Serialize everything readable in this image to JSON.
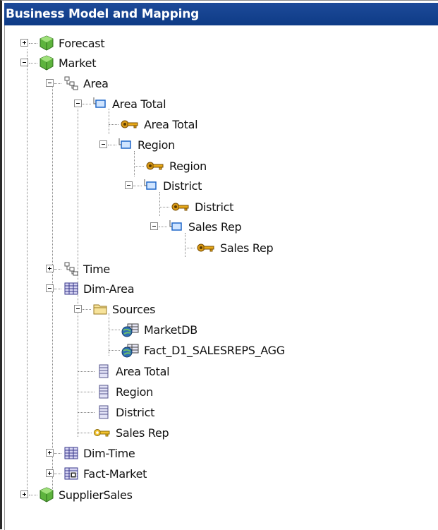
{
  "title": "Business Model and Mapping",
  "tree": {
    "forecast": "Forecast",
    "market": "Market",
    "area": "Area",
    "area_total_level": "Area Total",
    "area_total_key": "Area Total",
    "region_level": "Region",
    "region_key": "Region",
    "district_level": "District",
    "district_key": "District",
    "salesrep_level": "Sales Rep",
    "salesrep_key": "Sales Rep",
    "time": "Time",
    "dim_area": "Dim-Area",
    "sources": "Sources",
    "marketdb": "MarketDB",
    "fact_d1": "Fact_D1_SALESREPS_AGG",
    "col_area_total": "Area Total",
    "col_region": "Region",
    "col_district": "District",
    "col_sales_rep": "Sales Rep",
    "dim_time": "Dim-Time",
    "fact_market": "Fact-Market",
    "supplier_sales": "SupplierSales"
  },
  "icons": {
    "cube": "green-cube-icon",
    "hierarchy": "dimension-hierarchy-icon",
    "level": "level-icon",
    "key": "key-icon",
    "table": "logical-table-icon",
    "folder": "folder-icon",
    "source": "table-source-icon",
    "column": "column-icon",
    "fact": "fact-table-icon"
  }
}
